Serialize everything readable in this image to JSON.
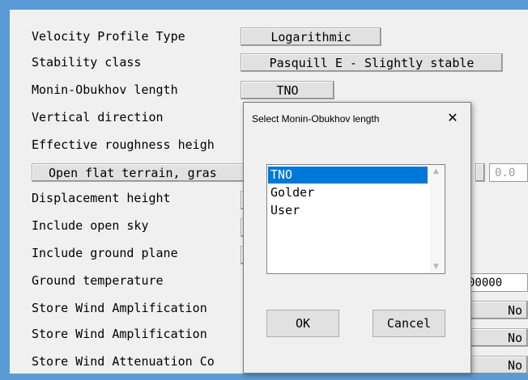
{
  "rows": {
    "velocity_profile_label": "Velocity Profile Type",
    "velocity_profile_value": "Logarithmic",
    "stability_label": "Stability class",
    "stability_value": "Pasquill E - Slightly stable",
    "monin_label": "Monin-Obukhov length",
    "monin_value": "TNO",
    "vertical_label": "Vertical direction",
    "roughness_label": "Effective roughness heigh",
    "terrain_button": "Open flat terrain, gras",
    "roughness_value": "0.0",
    "displacement_label": "Displacement height",
    "open_sky_label": "Include open sky",
    "ground_plane_label": "Include ground plane",
    "ground_temp_label": "Ground temperature",
    "ground_temp_value": "00000",
    "store_amp1_label": "Store Wind Amplification",
    "store_amp1_value": "No",
    "store_amp2_label": "Store Wind Amplification",
    "store_amp2_value": "No",
    "store_atten_label": "Store Wind Attenuation Co",
    "store_atten_value": "No"
  },
  "dialog": {
    "title": "Select Monin-Obukhov length",
    "close_glyph": "✕",
    "items": [
      "TNO",
      "Golder",
      "User"
    ],
    "selected": "TNO",
    "ok_label": "OK",
    "cancel_label": "Cancel"
  },
  "icons": {
    "scroll_up": "▲",
    "scroll_down": "▼"
  },
  "colors": {
    "frame": "#5b9bd5",
    "selection": "#0078d7"
  }
}
